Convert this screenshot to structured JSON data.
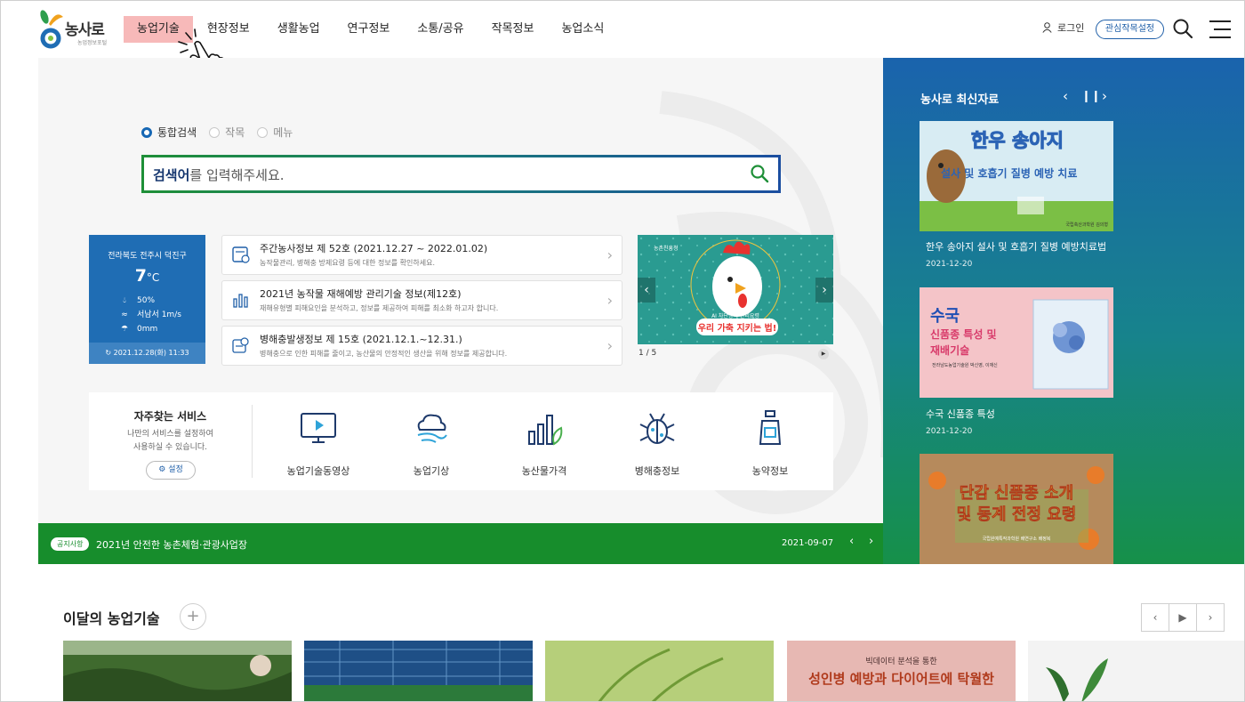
{
  "header": {
    "logo_text": "농사로",
    "logo_sub": "농업정보포털",
    "nav": [
      "농업기술",
      "현장정보",
      "생활농업",
      "연구정보",
      "소통/공유",
      "작목정보",
      "농업소식"
    ],
    "login": "로그인",
    "fav_button": "관심작목설정"
  },
  "search": {
    "options": [
      "통합검색",
      "작목",
      "메뉴"
    ],
    "selected": "통합검색",
    "placeholder_bold": "검색어",
    "placeholder_rest": "를 입력해주세요."
  },
  "weather": {
    "location": "전라북도 전주시 덕진구",
    "temp": "7",
    "unit": "°C",
    "humidity": "50%",
    "wind": "서남서 1m/s",
    "rain": "0mm",
    "updated": "2021.12.28(화) 11:33"
  },
  "info_list": [
    {
      "title": "주간농사정보 제 52호 (2021.12.27 ~ 2022.01.02)",
      "desc": "농작물관리, 병해충 방제요령 등에 대한 정보를 확인하세요."
    },
    {
      "title": "2021년 농작물 재해예방 관리기술 정보(제12호)",
      "desc": "재해유형별 피해요인을 분석하고, 정보를 제공하여 피해를 최소화 하고자 합니다."
    },
    {
      "title": "병해충발생정보 제 15호 (2021.12.1.~12.31.)",
      "desc": "병해충으로 인한 피해를 줄이고, 농산물의 안정적인 생산을 위해 정보를 제공합니다."
    }
  ],
  "banner": {
    "org": "농촌진흥청",
    "sub": "AI 차단방역 관리요령",
    "main": "우리 가축 지키는 법!",
    "counter": "1 / 5"
  },
  "services": {
    "title": "자주찾는 서비스",
    "desc_line1": "나만의 서비스를 설정하여",
    "desc_line2": "사용하실 수 있습니다.",
    "setting": "설정",
    "items": [
      {
        "label": "농업기술동영상",
        "icon": "monitor-play-icon"
      },
      {
        "label": "농업기상",
        "icon": "weather-icon"
      },
      {
        "label": "농산물가격",
        "icon": "bar-chart-icon"
      },
      {
        "label": "병해충정보",
        "icon": "bug-icon"
      },
      {
        "label": "농약정보",
        "icon": "pesticide-bottle-icon"
      }
    ]
  },
  "notice": {
    "badge": "공지사항",
    "text": "2021년 안전한 농촌체험·관광사업장",
    "date": "2021-09-07"
  },
  "right_panel": {
    "title": "농사로 최신자료",
    "cards": [
      {
        "img_title": "한우 송아지",
        "img_sub": "설사 및 호흡기 질병 예방 치료",
        "img_author": "국립축산과학원 김의형",
        "title": "한우 송아지 설사 및 호흡기 질병 예방치료법",
        "date": "2021-12-20"
      },
      {
        "img_title": "수국",
        "img_sub1": "신품종 특성 및",
        "img_sub2": "재배기술",
        "img_author": "전라남도농업기술원 박신영, 이재신",
        "title": "수국 신품종 특성",
        "date": "2021-12-20"
      },
      {
        "img_title": "단감 신품종 소개",
        "img_sub": "및 동계 전정 요령",
        "img_author": "국립원예특작과학원 배연구소 배정복"
      }
    ]
  },
  "monthly": {
    "title": "이달의 농업기술",
    "thumb4_top": "빅데이터 분석을 통한",
    "thumb4_main": "성인병 예방과 다이어트에 탁월한"
  },
  "colors": {
    "primary_blue": "#1f5fa8",
    "nav_highlight": "#f7b9b9",
    "notice_green": "#178d2c"
  }
}
